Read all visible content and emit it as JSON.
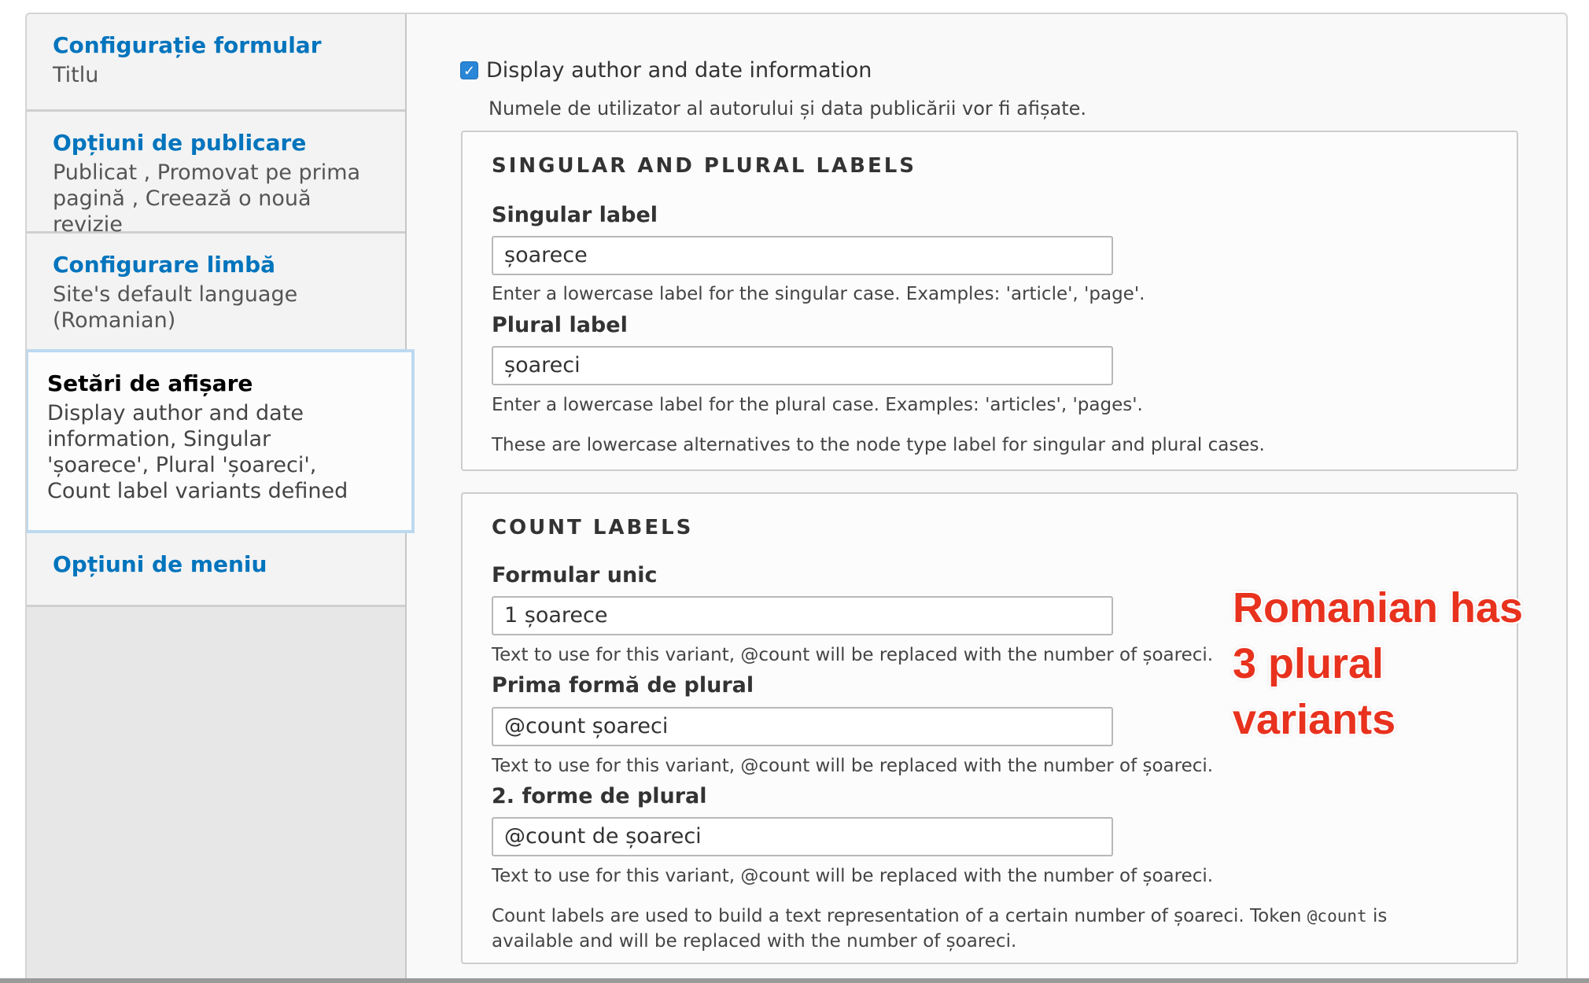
{
  "colors": {
    "accent": "#0074bd",
    "checkbox": "#2a86d6",
    "annotation": "#e8321e"
  },
  "sidebar": {
    "tabs": [
      {
        "title": "Configurație formular",
        "summary": "Titlu"
      },
      {
        "title": "Opțiuni de publicare",
        "summary": "Publicat , Promovat pe prima pagină , Creează o nouă revizie"
      },
      {
        "title": "Configurare limbă",
        "summary": "Site's default language (Romanian)"
      },
      {
        "title": "Setări de afișare",
        "summary": "Display author and date information, Singular 'șoarece', Plural 'șoareci', Count label variants defined",
        "selected": true
      },
      {
        "title": "Opțiuni de meniu",
        "summary": ""
      }
    ]
  },
  "main": {
    "display_author": {
      "checked": true,
      "label": "Display author and date information",
      "description": "Numele de utilizator al autorului și data publicării vor fi afișate."
    },
    "singular_plural": {
      "legend": "SINGULAR AND PLURAL LABELS",
      "singular": {
        "label": "Singular label",
        "value": "șoarece",
        "description": "Enter a lowercase label for the singular case. Examples: 'article', 'page'."
      },
      "plural": {
        "label": "Plural label",
        "value": "șoareci",
        "description": "Enter a lowercase label for the plural case. Examples: 'articles', 'pages'."
      },
      "footer": "These are lowercase alternatives to the node type label for singular and plural cases."
    },
    "count_labels": {
      "legend": "COUNT LABELS",
      "fields": [
        {
          "label": "Formular unic",
          "value": "1 șoarece",
          "description": "Text to use for this variant, @count will be replaced with the number of șoareci."
        },
        {
          "label": "Prima formă de plural",
          "value": "@count șoareci",
          "description": "Text to use for this variant, @count will be replaced with the number of șoareci."
        },
        {
          "label": "2. forme de plural",
          "value": "@count de șoareci",
          "description": "Text to use for this variant, @count will be replaced with the number of șoareci."
        }
      ],
      "footer_before": "Count labels are used to build a text representation of a certain number of șoareci. Token ",
      "footer_token": "@count",
      "footer_after": " is available and will be replaced with the number of șoareci."
    }
  },
  "annotation": {
    "line1": "Romanian has",
    "line2": "3 plural",
    "line3": "variants"
  }
}
